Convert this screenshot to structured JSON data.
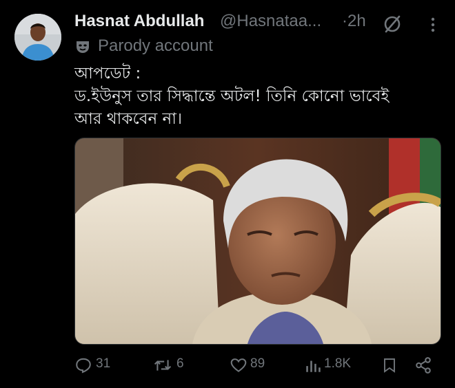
{
  "tweet": {
    "author": {
      "display_name": "Hasnat Abdullah",
      "handle": "@Hasnataa...",
      "avatar_icon": "user-avatar"
    },
    "time_ago": "2h",
    "parody_label": "Parody account",
    "text_lines": [
      "আপডেট :",
      "ড.ইউনুস তার সিদ্ধান্তে অটল! তিনি কোনো ভাবেই",
      "আর থাকবেন না।"
    ],
    "actions": {
      "replies": "31",
      "reposts": "6",
      "likes": "89",
      "views": "1.8K"
    }
  },
  "colors": {
    "background": "#000000",
    "text_primary": "#e7e9ea",
    "text_secondary": "#71767b"
  },
  "icons": [
    "grok-icon",
    "more-icon",
    "mask-icon",
    "reply-icon",
    "repost-icon",
    "like-icon",
    "views-icon",
    "bookmark-icon",
    "share-icon"
  ]
}
